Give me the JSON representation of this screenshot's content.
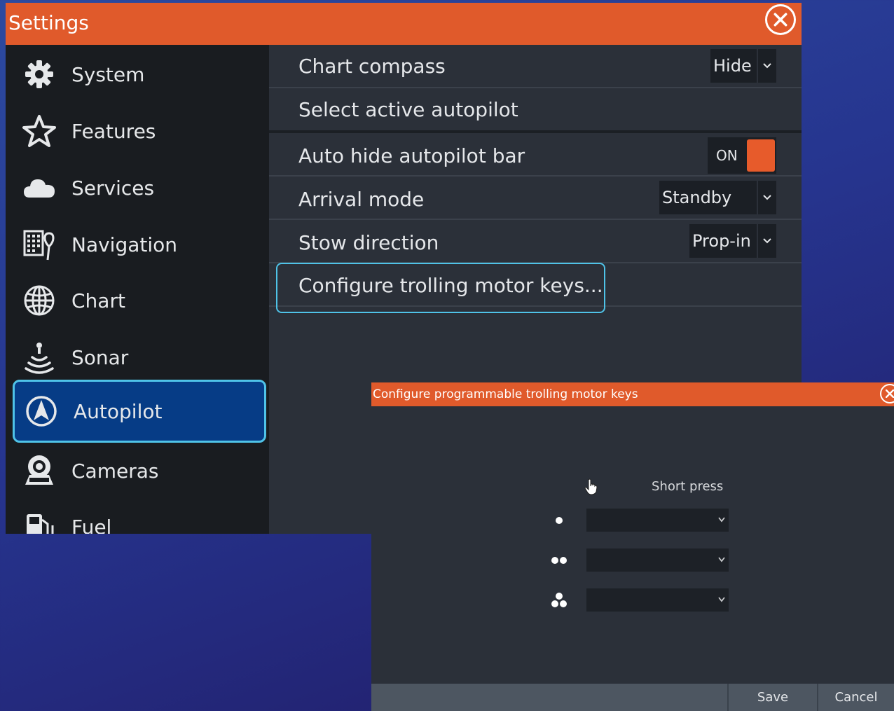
{
  "settings": {
    "title": "Settings",
    "sidebar": [
      {
        "label": "System",
        "icon": "gear-icon"
      },
      {
        "label": "Features",
        "icon": "star-icon"
      },
      {
        "label": "Services",
        "icon": "cloud-icon"
      },
      {
        "label": "Navigation",
        "icon": "navigation-icon"
      },
      {
        "label": "Chart",
        "icon": "globe-icon"
      },
      {
        "label": "Sonar",
        "icon": "sonar-icon"
      },
      {
        "label": "Autopilot",
        "icon": "autopilot-icon",
        "active": true
      },
      {
        "label": "Cameras",
        "icon": "camera-icon"
      },
      {
        "label": "Fuel",
        "icon": "fuel-icon"
      }
    ],
    "rows": {
      "chart_compass": {
        "label": "Chart compass",
        "value": "Hide"
      },
      "select_autopilot": {
        "label": "Select active autopilot"
      },
      "auto_hide": {
        "label": "Auto hide autopilot bar",
        "toggle_text": "ON",
        "state": "on"
      },
      "arrival_mode": {
        "label": "Arrival mode",
        "value": "Standby"
      },
      "stow_direction": {
        "label": "Stow direction",
        "value": "Prop-in"
      },
      "configure": {
        "label": "Configure trolling motor keys..."
      }
    }
  },
  "dialog": {
    "title": "Configure programmable trolling motor keys",
    "column_header": "Short press",
    "keys": [
      {
        "icon": "one-dot-icon",
        "value": ""
      },
      {
        "icon": "two-dots-icon",
        "value": ""
      },
      {
        "icon": "three-dots-icon",
        "value": ""
      }
    ],
    "save_label": "Save",
    "cancel_label": "Cancel"
  },
  "colors": {
    "accent": "#e05a2b",
    "selection": "#063c86",
    "focus_border": "#4fc3e8"
  }
}
